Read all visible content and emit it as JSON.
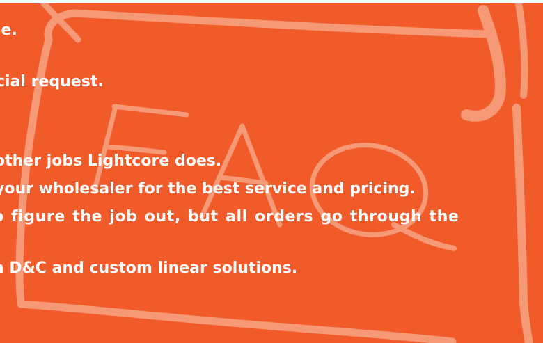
{
  "colors": {
    "background": "#f15a29",
    "text": "#ffffff",
    "sketch": "#f7a07f"
  },
  "decoration": {
    "icon": "hand-drawn-faq-tag-icon",
    "art_text": "FAQ"
  },
  "lines": [
    "le.",
    "cial request.",
    "other jobs Lightcore does.",
    "your wholesaler for the best service and pricing.",
    "o figure the job out, but all orders go through the",
    "h D&C and custom linear solutions."
  ]
}
